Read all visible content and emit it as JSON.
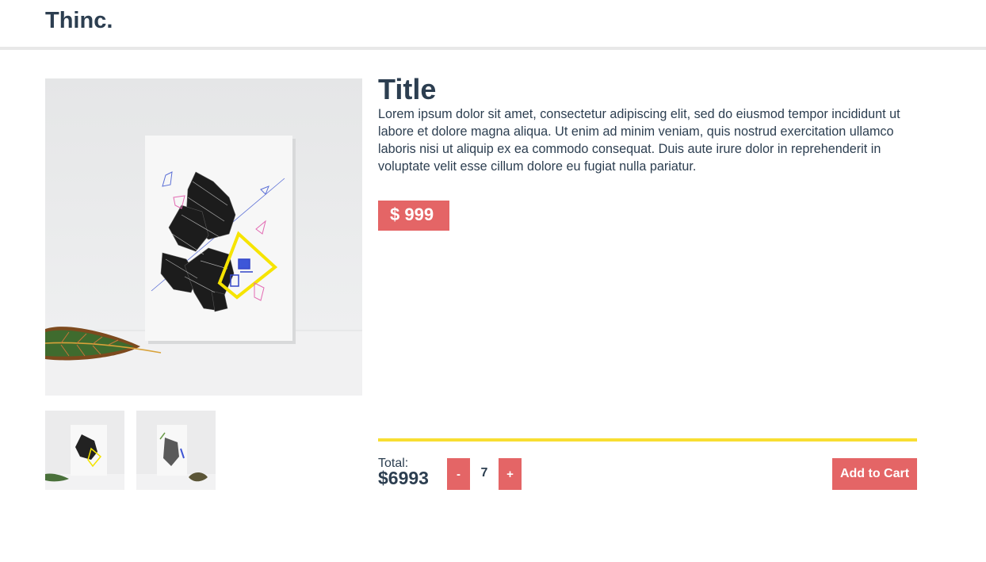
{
  "header": {
    "brand": "Thinc."
  },
  "gallery": {
    "main_image": "poster-mockup-image",
    "thumbnails": [
      "poster-thumbnail-1",
      "poster-thumbnail-2"
    ]
  },
  "product": {
    "title": "Title",
    "description": "Lorem ipsum dolor sit amet, consectetur adipiscing elit, sed do eiusmod tempor incididunt ut labore et dolore magna aliqua. Ut enim ad minim veniam, quis nostrud exercitation ullamco laboris nisi ut aliquip ex ea commodo consequat. Duis aute irure dolor in reprehenderit in voluptate velit esse cillum dolore eu fugiat nulla pariatur.",
    "price": "$ 999"
  },
  "cart": {
    "total_label": "Total:",
    "total_value": "$6993",
    "minus_label": "-",
    "quantity": "7",
    "plus_label": "+",
    "add_label": "Add to Cart"
  },
  "colors": {
    "text": "#2c3e50",
    "accent": "#e46566",
    "divider": "#f8de32",
    "header_border": "#e8e8e8"
  }
}
